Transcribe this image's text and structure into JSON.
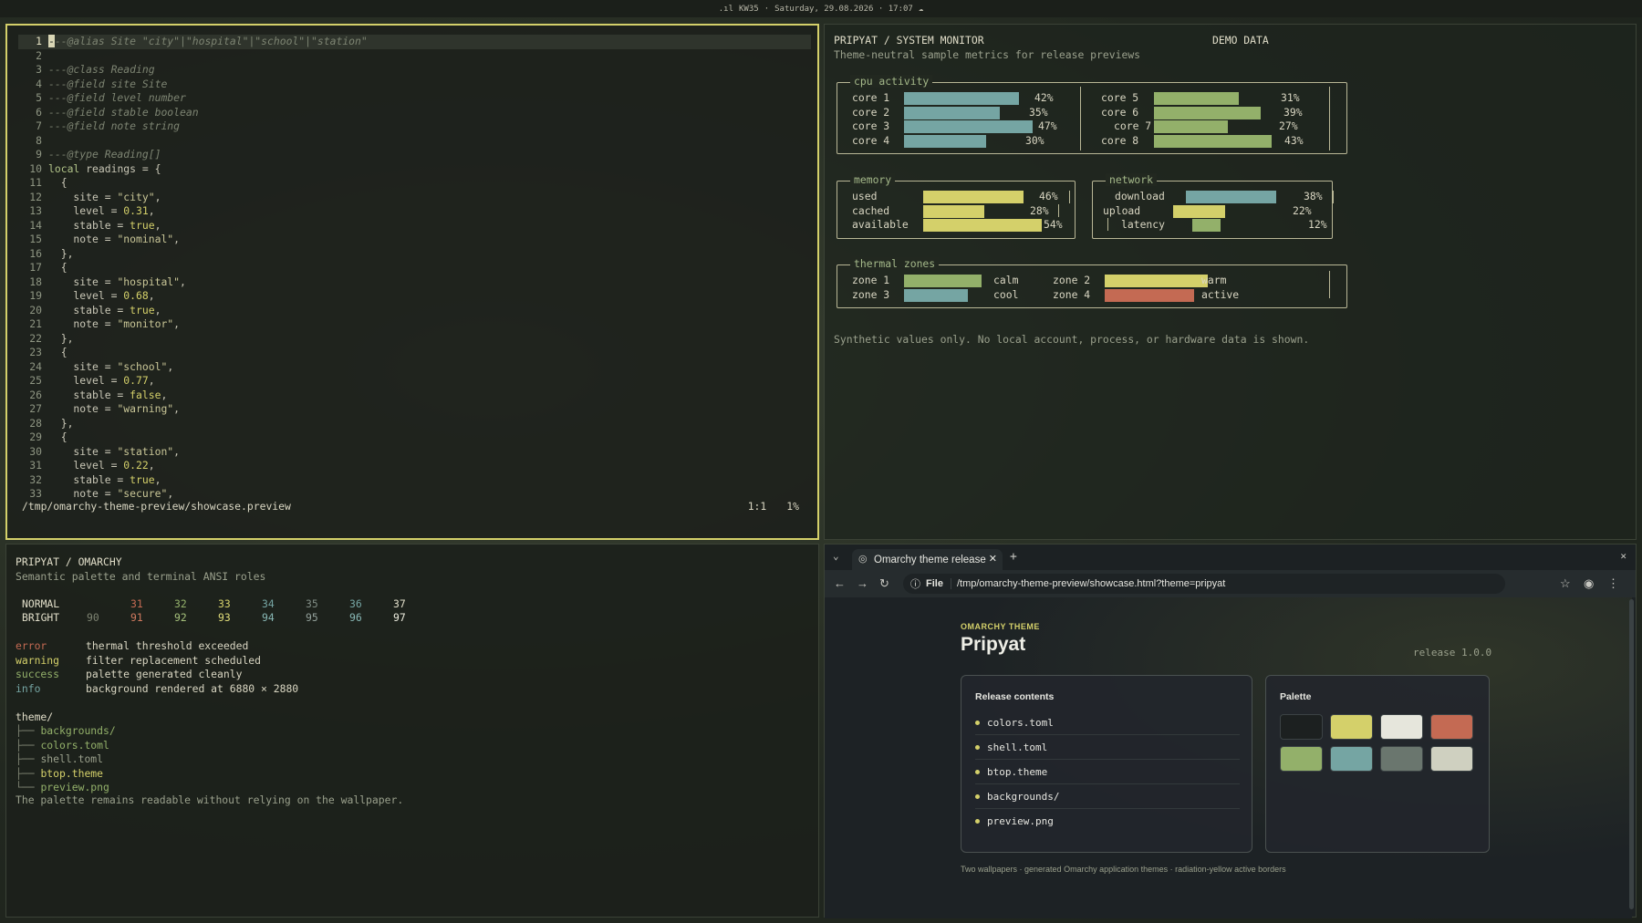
{
  "topbar": {
    "workspace": "KW35",
    "datetime": "Saturday, 29.08.2026 · 17:07"
  },
  "editor": {
    "lines": [
      {
        "n": "1",
        "html": "<span class=\"cursor\">-</span><span class=\"cm\">--@alias Site \"city\"|\"hospital\"|\"school\"|\"station\"</span>"
      },
      {
        "n": "2",
        "html": ""
      },
      {
        "n": "3",
        "html": "<span class=\"cm\">---@class Reading</span>"
      },
      {
        "n": "4",
        "html": "<span class=\"cm\">---@field site Site</span>"
      },
      {
        "n": "5",
        "html": "<span class=\"cm\">---@field level number</span>"
      },
      {
        "n": "6",
        "html": "<span class=\"cm\">---@field stable boolean</span>"
      },
      {
        "n": "7",
        "html": "<span class=\"cm\">---@field note string</span>"
      },
      {
        "n": "8",
        "html": ""
      },
      {
        "n": "9",
        "html": "<span class=\"cm\">---@type Reading[]</span>"
      },
      {
        "n": "10",
        "html": "<span class=\"kw\">local</span> readings = {"
      },
      {
        "n": "11",
        "html": "  {"
      },
      {
        "n": "12",
        "html": "    site = <span class=\"str\">\"city\"</span>,"
      },
      {
        "n": "13",
        "html": "    level = <span class=\"num\">0.31</span>,"
      },
      {
        "n": "14",
        "html": "    stable = <span class=\"bool\">true</span>,"
      },
      {
        "n": "15",
        "html": "    note = <span class=\"str\">\"nominal\"</span>,"
      },
      {
        "n": "16",
        "html": "  },"
      },
      {
        "n": "17",
        "html": "  {"
      },
      {
        "n": "18",
        "html": "    site = <span class=\"str\">\"hospital\"</span>,"
      },
      {
        "n": "19",
        "html": "    level = <span class=\"num\">0.68</span>,"
      },
      {
        "n": "20",
        "html": "    stable = <span class=\"bool\">true</span>,"
      },
      {
        "n": "21",
        "html": "    note = <span class=\"str\">\"monitor\"</span>,"
      },
      {
        "n": "22",
        "html": "  },"
      },
      {
        "n": "23",
        "html": "  {"
      },
      {
        "n": "24",
        "html": "    site = <span class=\"str\">\"school\"</span>,"
      },
      {
        "n": "25",
        "html": "    level = <span class=\"num\">0.77</span>,"
      },
      {
        "n": "26",
        "html": "    stable = <span class=\"bool\">false</span>,"
      },
      {
        "n": "27",
        "html": "    note = <span class=\"str\">\"warning\"</span>,"
      },
      {
        "n": "28",
        "html": "  },"
      },
      {
        "n": "29",
        "html": "  {"
      },
      {
        "n": "30",
        "html": "    site = <span class=\"str\">\"station\"</span>,"
      },
      {
        "n": "31",
        "html": "    level = <span class=\"num\">0.22</span>,"
      },
      {
        "n": "32",
        "html": "    stable = <span class=\"bool\">true</span>,"
      },
      {
        "n": "33",
        "html": "    note = <span class=\"str\">\"secure\"</span>,"
      }
    ],
    "status_path": "/tmp/omarchy-theme-preview/showcase.preview",
    "status_pos": "1:1",
    "status_pct": "1%"
  },
  "monitor": {
    "title": "PRIPYAT / SYSTEM MONITOR",
    "subtitle": "Theme-neutral sample metrics for release previews",
    "demo": "DEMO DATA",
    "cpu_label": "cpu activity",
    "cpu": [
      {
        "name": "core 1",
        "pct": "42%",
        "value": 0.42
      },
      {
        "name": "core 2",
        "pct": "35%",
        "value": 0.35
      },
      {
        "name": "core 3",
        "pct": "47%",
        "value": 0.47
      },
      {
        "name": "core 4",
        "pct": "30%",
        "value": 0.3
      },
      {
        "name": "core 5",
        "pct": "31%",
        "value": 0.31
      },
      {
        "name": "core 6",
        "pct": "39%",
        "value": 0.39
      },
      {
        "name": "core 7",
        "pct": "27%",
        "value": 0.27
      },
      {
        "name": "core 8",
        "pct": "43%",
        "value": 0.43
      }
    ],
    "memory_label": "memory",
    "memory": [
      {
        "name": "used",
        "pct": "46%",
        "value": 0.46
      },
      {
        "name": "cached",
        "pct": "28%",
        "value": 0.28
      },
      {
        "name": "available",
        "pct": "54%",
        "value": 0.54
      }
    ],
    "network_label": "network",
    "network": [
      {
        "name": "download",
        "pct": "38%",
        "value": 0.38
      },
      {
        "name": "upload",
        "pct": "22%",
        "value": 0.22
      },
      {
        "name": "latency",
        "pct": "12%",
        "value": 0.12
      }
    ],
    "thermal_label": "thermal zones",
    "thermal": [
      {
        "name": "zone 1",
        "state": "calm",
        "color": "#93b06a"
      },
      {
        "name": "zone 2",
        "state": "warm",
        "color": "#d4d06a"
      },
      {
        "name": "zone 3",
        "state": "cool",
        "color": "#75a5a3"
      },
      {
        "name": "zone 4",
        "state": "active",
        "color": "#c46a53"
      }
    ],
    "footer": "Synthetic values only. No local account, process, or hardware data is shown."
  },
  "terminal": {
    "title": "PRIPYAT / OMARCHY",
    "subtitle": "Semantic palette and terminal ANSI roles",
    "normal_label": "NORMAL",
    "bright_label": "BRIGHT",
    "normal": [
      "31",
      "32",
      "33",
      "34",
      "35",
      "36",
      "37"
    ],
    "bright": [
      "90",
      "91",
      "92",
      "93",
      "94",
      "95",
      "96",
      "97"
    ],
    "roles": [
      {
        "role": "error",
        "text": "thermal threshold exceeded",
        "color": "#c46a53"
      },
      {
        "role": "warning",
        "text": "filter replacement scheduled",
        "color": "#d4d06a"
      },
      {
        "role": "success",
        "text": "palette generated cleanly",
        "color": "#93b06a"
      },
      {
        "role": "info",
        "text": "background rendered at 6880 × 2880",
        "color": "#75a5a3"
      }
    ],
    "tree_root": "theme/",
    "tree": [
      "├── backgrounds/",
      "├── colors.toml",
      "├── shell.toml",
      "├── btop.theme",
      "└── preview.png"
    ],
    "footer": "The palette remains readable without relying on the wallpaper."
  },
  "browser": {
    "tab_title": "Omarchy theme release",
    "url_scheme": "File",
    "url": "/tmp/omarchy-theme-preview/showcase.html?theme=pripyat",
    "kicker": "OMARCHY THEME",
    "heading": "Pripyat",
    "release": "release 1.0.0",
    "contents_title": "Release contents",
    "contents": [
      "colors.toml",
      "shell.toml",
      "btop.theme",
      "backgrounds/",
      "preview.png"
    ],
    "palette_title": "Palette",
    "palette": [
      "#1c2020",
      "#d4d06a",
      "#e6e6dc",
      "#c46a53",
      "#93b06a",
      "#75a5a3",
      "#6a766e",
      "#cfd0c0"
    ],
    "footer": "Two wallpapers · generated Omarchy application themes · radiation-yellow active borders"
  }
}
